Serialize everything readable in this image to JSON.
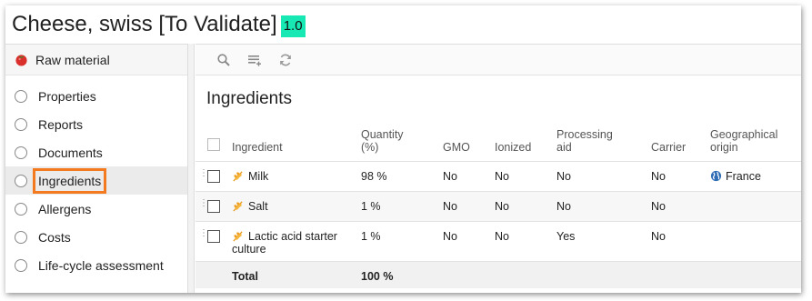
{
  "header": {
    "title": "Cheese, swiss [To Validate]",
    "version": "1.0"
  },
  "sidebar": {
    "root_label": "Raw material",
    "items": [
      {
        "label": "Properties"
      },
      {
        "label": "Reports"
      },
      {
        "label": "Documents"
      },
      {
        "label": "Ingredients",
        "active": true
      },
      {
        "label": "Allergens"
      },
      {
        "label": "Costs"
      },
      {
        "label": "Life-cycle assessment"
      }
    ]
  },
  "toolbar": {
    "buttons": [
      "search-icon",
      "add-list-icon",
      "refresh-icon"
    ]
  },
  "main": {
    "section_title": "Ingredients",
    "table": {
      "headers": {
        "ingredient": "Ingredient",
        "quantity_l1": "Quantity",
        "quantity_l2": "(%)",
        "gmo": "GMO",
        "ionized": "Ionized",
        "processing_l1": "Processing",
        "processing_l2": "aid",
        "carrier": "Carrier",
        "geo_l1": "Geographical",
        "geo_l2": "origin"
      },
      "rows": [
        {
          "ingredient": "Milk",
          "quantity": "98 %",
          "gmo": "No",
          "ionized": "No",
          "processing_aid": "No",
          "carrier": "No",
          "origin": "France"
        },
        {
          "ingredient": "Salt",
          "quantity": "1 %",
          "gmo": "No",
          "ionized": "No",
          "processing_aid": "No",
          "carrier": "No",
          "origin": ""
        },
        {
          "ingredient": "Lactic acid starter culture",
          "quantity": "1 %",
          "gmo": "No",
          "ionized": "No",
          "processing_aid": "Yes",
          "carrier": "No",
          "origin": ""
        }
      ],
      "total": {
        "label": "Total",
        "quantity": "100 %"
      }
    }
  },
  "colors": {
    "version_badge": "#18e8b4",
    "active_outline": "#f47a20",
    "leaf": "#f0a020",
    "tomato": "#d9302c",
    "globe": "#2f6db5"
  }
}
